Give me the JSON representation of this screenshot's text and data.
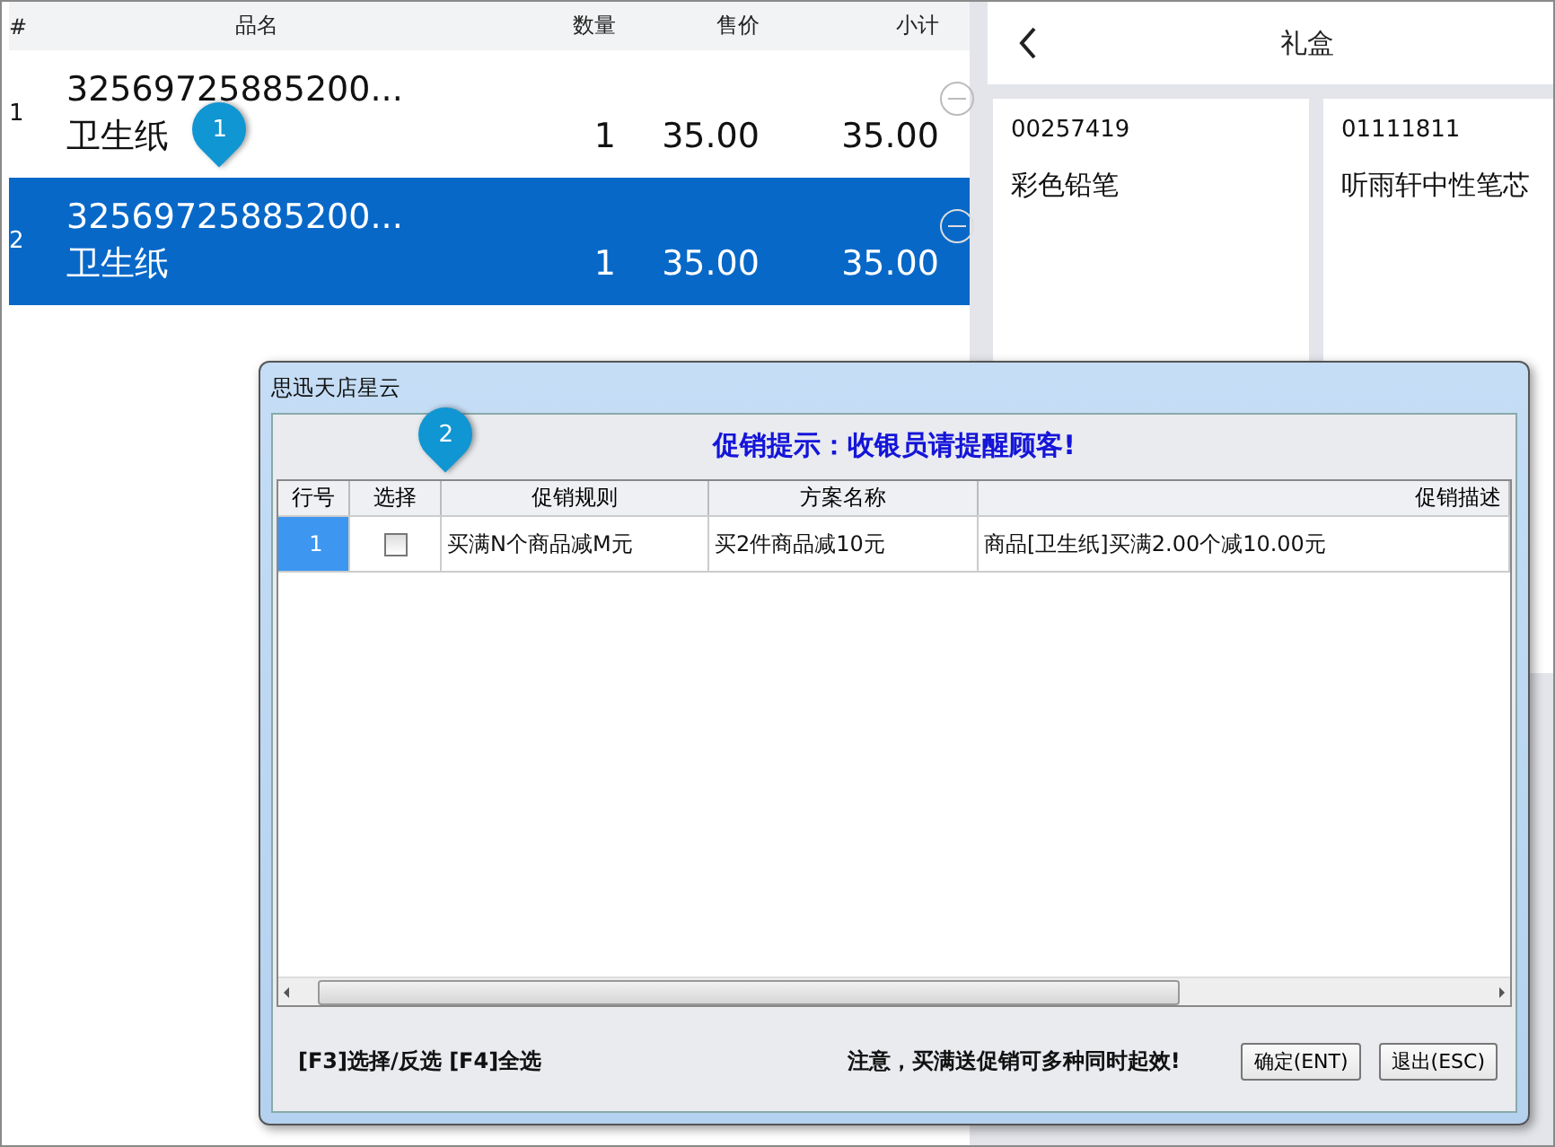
{
  "cart": {
    "columns": [
      "#",
      "品名",
      "数量",
      "售价",
      "小计"
    ],
    "rows": [
      {
        "index": "1",
        "code": "32569725885200...",
        "name": "卫生纸",
        "qty": "1",
        "price": "35.00",
        "subtotal": "35.00",
        "selected": false
      },
      {
        "index": "2",
        "code": "32569725885200...",
        "name": "卫生纸",
        "qty": "1",
        "price": "35.00",
        "subtotal": "35.00",
        "selected": true
      }
    ]
  },
  "category": {
    "title": "礼盒",
    "products": [
      {
        "code": "00257419",
        "name": "彩色铅笔"
      },
      {
        "code": "01111811",
        "name": "听雨轩中性笔芯"
      }
    ]
  },
  "callouts": [
    {
      "label": "1"
    },
    {
      "label": "2"
    }
  ],
  "dialog": {
    "title": "思迅天店星云",
    "heading": "促销提示：收银员请提醒顾客!",
    "columns": [
      "行号",
      "选择",
      "促销规则",
      "方案名称",
      "促销描述"
    ],
    "rows": [
      {
        "index": "1",
        "checked": false,
        "rule": "买满N个商品减M元",
        "plan": "买2件商品减10元",
        "description": "商品[卫生纸]买满2.00个减10.00元",
        "selected": true
      }
    ],
    "hint": "[F3]选择/反选 [F4]全选",
    "notice": "注意，买满送促销可多种同时起效!",
    "buttons": [
      "确定(ENT)",
      "退出(ESC)"
    ]
  }
}
